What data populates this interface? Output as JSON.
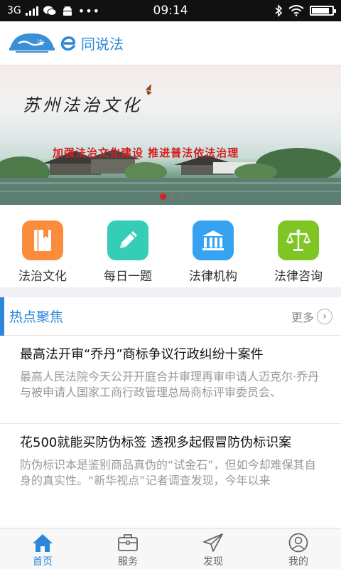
{
  "status_bar": {
    "network": "3G",
    "time": "09:14",
    "battery_level": 0.85
  },
  "header": {
    "brand_name": "同说法",
    "brand_letter": "e"
  },
  "banner": {
    "calligraphy": "苏州法治文化",
    "slogan": "加强法治文化建设  推进普法依法治理",
    "slide_count": 3,
    "active_slide": 1
  },
  "quick_menu": [
    {
      "label": "法治文化",
      "icon": "book-icon",
      "color": "#fb8c3c"
    },
    {
      "label": "每日一题",
      "icon": "pencil-icon",
      "color": "#35cdb8"
    },
    {
      "label": "法律机构",
      "icon": "institution-icon",
      "color": "#36a3f0"
    },
    {
      "label": "法律咨询",
      "icon": "scales-icon",
      "color": "#7fc524"
    }
  ],
  "hot_news": {
    "title": "热点聚焦",
    "more_label": "更多",
    "articles": [
      {
        "title": "最高法开审“乔丹”商标争议行政纠纷十案件",
        "summary": "最高人民法院今天公开开庭合并审理再审申请人迈克尔·乔丹与被申请人国家工商行政管理总局商标评审委员会、"
      },
      {
        "title": "花500就能买防伪标签 透视多起假冒防伪标识案",
        "summary": "防伪标识本是鉴别商品真伪的“试金石”，但如今却难保其自身的真实性。“新华视点”记者调查发现，今年以来"
      }
    ]
  },
  "tab_bar": [
    {
      "label": "首页",
      "icon": "home-icon",
      "active": true
    },
    {
      "label": "服务",
      "icon": "briefcase-icon",
      "active": false
    },
    {
      "label": "发现",
      "icon": "paper-plane-icon",
      "active": false
    },
    {
      "label": "我的",
      "icon": "user-icon",
      "active": false
    }
  ],
  "colors": {
    "accent": "#2b88d8",
    "slide_dot_active": "#e02020"
  }
}
